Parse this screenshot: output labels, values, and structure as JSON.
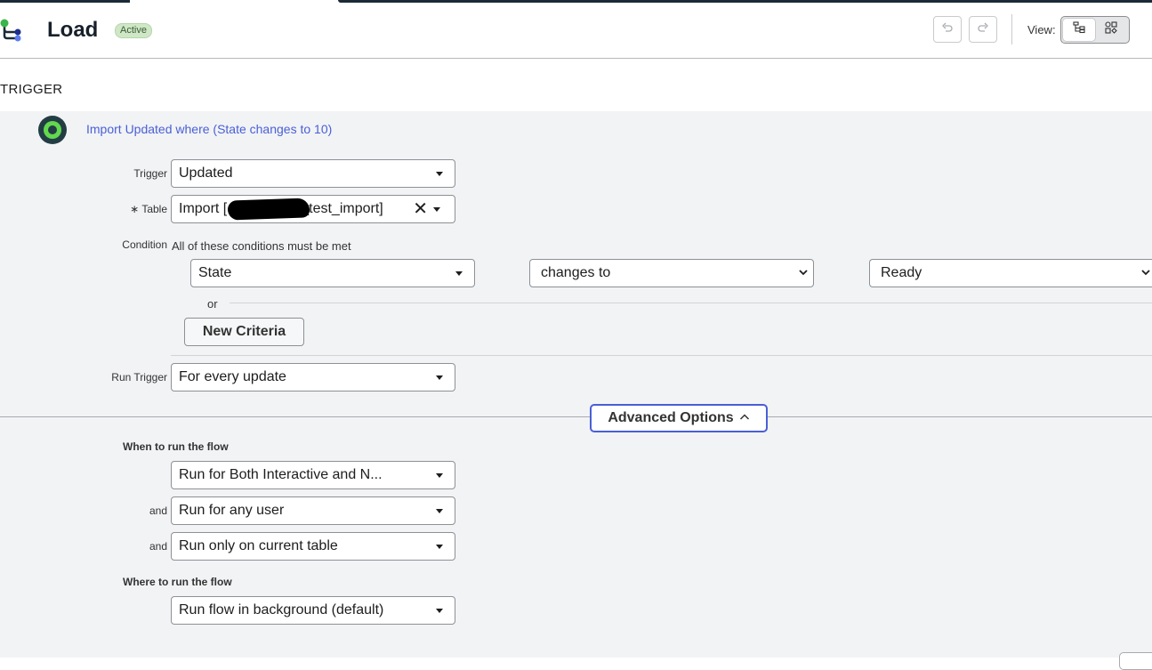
{
  "header": {
    "title": "Load",
    "status": "Active",
    "view_label": "View:"
  },
  "trigger": {
    "heading": "TRIGGER",
    "summary": "Import Updated where (State changes to 10)",
    "trigger_label": "Trigger",
    "trigger_value": "Updated",
    "table_required": "∗",
    "table_label": "Table",
    "table_value": "Import [",
    "table_value_suffix": "_test_import]",
    "condition_label": "Condition",
    "condition_hint": "All of these conditions must be met",
    "condition": {
      "field": "State",
      "operator": "changes to",
      "value": "Ready"
    },
    "or_label": "or",
    "new_criteria": "New Criteria",
    "run_trigger_label": "Run Trigger",
    "run_trigger_value": "For every update"
  },
  "advanced": {
    "button_label": "Advanced Options",
    "when_heading": "When to run the flow",
    "run_mode": "Run for Both Interactive and N...",
    "and_label": "and",
    "user_scope": "Run for any user",
    "table_scope": "Run only on current table",
    "where_heading": "Where to run the flow",
    "where_value": "Run flow in background (default)"
  },
  "icons": [
    "flow-logo-icon",
    "undo-icon",
    "redo-icon",
    "tree-view-icon",
    "grid-view-icon",
    "node-status-icon",
    "caret-down-icon",
    "clear-icon",
    "chevron-up-icon"
  ],
  "colors": {
    "accent": "#4a5fd6",
    "badge_bg": "#cfe7c7",
    "panel_bg": "#f1f3f5",
    "node_green": "#62d84e"
  }
}
